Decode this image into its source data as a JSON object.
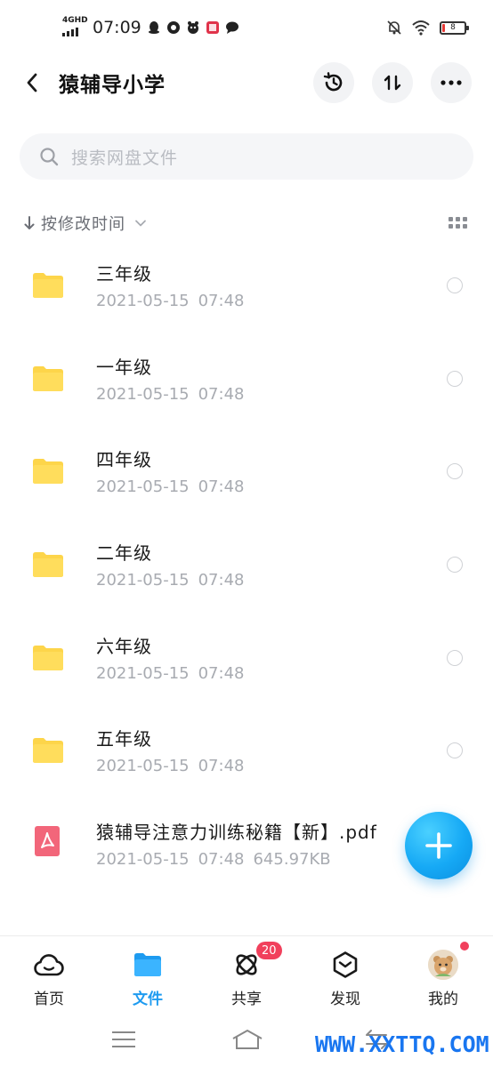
{
  "status_bar": {
    "network": "4GHD",
    "time": "07:09",
    "battery": "8"
  },
  "header": {
    "title": "猿辅导小学"
  },
  "search": {
    "placeholder": "搜索网盘文件"
  },
  "sort": {
    "label": "按修改时间"
  },
  "files": [
    {
      "name": "三年级",
      "date": "2021-05-15",
      "time": "07:48",
      "size": "",
      "type": "folder"
    },
    {
      "name": "一年级",
      "date": "2021-05-15",
      "time": "07:48",
      "size": "",
      "type": "folder"
    },
    {
      "name": "四年级",
      "date": "2021-05-15",
      "time": "07:48",
      "size": "",
      "type": "folder"
    },
    {
      "name": "二年级",
      "date": "2021-05-15",
      "time": "07:48",
      "size": "",
      "type": "folder"
    },
    {
      "name": "六年级",
      "date": "2021-05-15",
      "time": "07:48",
      "size": "",
      "type": "folder"
    },
    {
      "name": "五年级",
      "date": "2021-05-15",
      "time": "07:48",
      "size": "",
      "type": "folder"
    },
    {
      "name": "猿辅导注意力训练秘籍【新】.pdf",
      "date": "2021-05-15",
      "time": "07:48",
      "size": "645.97KB",
      "type": "pdf"
    }
  ],
  "bottom_nav": {
    "home": "首页",
    "files": "文件",
    "share": "共享",
    "share_badge": "20",
    "discover": "发现",
    "mine": "我的"
  },
  "watermark": "WWW.XXTTQ.COM",
  "colors": {
    "accent": "#1e9bf0",
    "folder": "#fdd54a",
    "pdf": "#f2667a",
    "badge": "#f1405c"
  }
}
